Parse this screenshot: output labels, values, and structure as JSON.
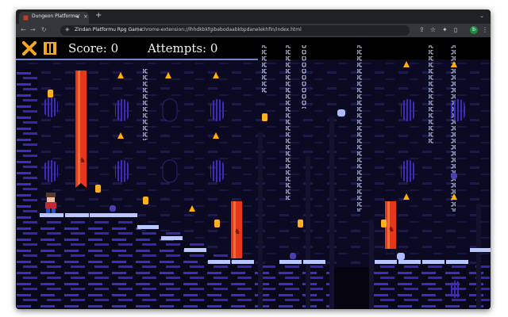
{
  "browser": {
    "tab_title": "Dungeon Platformer",
    "tab_close_glyph": "×",
    "tab_audio_glyph": "◂",
    "new_tab_glyph": "+",
    "tab_search_glyph": "⌄",
    "omnibox_extension_label": "Zindan Platformu Rpg Game",
    "omnibox_url": "chrome-extension://lhhdkbkfgibebodaabkbpdanelekhfin/index.html",
    "profile_initial": "b",
    "icons": [
      "back-arrow-icon",
      "forward-arrow-icon",
      "reload-icon",
      "puzzle-lock-icon",
      "share-icon",
      "bookmark-star-icon",
      "extensions-icon",
      "sidebar-icon",
      "menu-icon"
    ]
  },
  "hud": {
    "score_label": "Score: 0",
    "attempts_label": "Attempts: 0",
    "close_icon": "close-x-icon",
    "pause_icon": "pause-icon",
    "accent_color": "#f5a623"
  },
  "colors": {
    "wall": "#1a1440",
    "brick": "#4230c8",
    "platform": "#b8c8ff",
    "banner": "#e8361c",
    "chain": "#c8d8ff",
    "coin": "#ffb020",
    "torch": "#ffb000"
  }
}
